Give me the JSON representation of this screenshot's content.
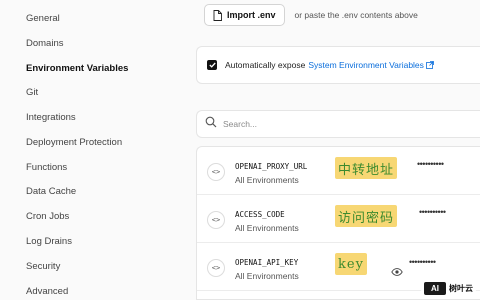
{
  "sidebar": {
    "items": [
      {
        "label": "General",
        "active": false
      },
      {
        "label": "Domains",
        "active": false
      },
      {
        "label": "Environment Variables",
        "active": true
      },
      {
        "label": "Git",
        "active": false
      },
      {
        "label": "Integrations",
        "active": false
      },
      {
        "label": "Deployment Protection",
        "active": false
      },
      {
        "label": "Functions",
        "active": false
      },
      {
        "label": "Data Cache",
        "active": false
      },
      {
        "label": "Cron Jobs",
        "active": false
      },
      {
        "label": "Log Drains",
        "active": false
      },
      {
        "label": "Security",
        "active": false
      },
      {
        "label": "Advanced",
        "active": false
      }
    ]
  },
  "import": {
    "button_label": "Import .env",
    "hint": "or paste the .env contents above"
  },
  "expose": {
    "checked": true,
    "label": "Automatically expose",
    "link": "System Environment Variables"
  },
  "search": {
    "placeholder": "Search..."
  },
  "env_vars": [
    {
      "key": "OPENAI_PROXY_URL",
      "scope": "All Environments",
      "annotation": "中转地址",
      "masked": "••••••••••",
      "has_eye": false
    },
    {
      "key": "ACCESS_CODE",
      "scope": "All Environments",
      "annotation": "访问密码",
      "masked": "••••••••••",
      "has_eye": false
    },
    {
      "key": "OPENAI_API_KEY",
      "scope": "All Environments",
      "annotation": "key",
      "masked": "••••••••••",
      "has_eye": true
    }
  ],
  "watermark": {
    "logo": "AI",
    "text": "树叶云"
  },
  "colors": {
    "link": "#0a6edc",
    "highlight": "#f7d774",
    "annotation_text": "#3c8a2e"
  }
}
